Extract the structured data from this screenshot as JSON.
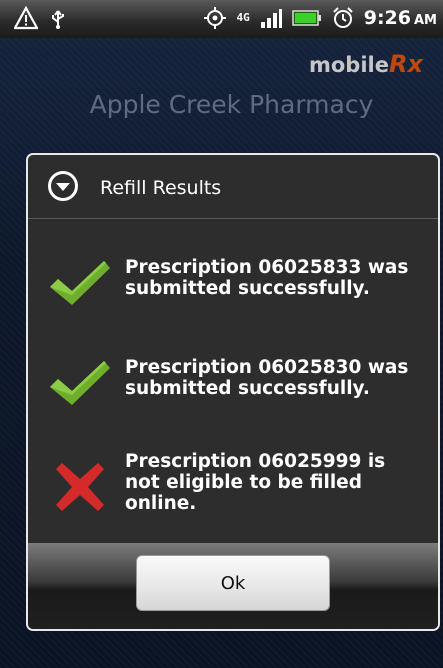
{
  "status_bar": {
    "time": "9:26",
    "ampm": "AM",
    "network_label": "4G",
    "icons": [
      "warning-icon",
      "usb-icon",
      "gps-icon",
      "data-4g-icon",
      "signal-icon",
      "battery-icon",
      "alarm-icon"
    ]
  },
  "app": {
    "brand_prefix": "mobile",
    "brand_rx": "Rx",
    "pharmacy_name": "Apple Creek Pharmacy"
  },
  "dialog": {
    "title": "Refill Results",
    "results": [
      {
        "icon": "check-icon",
        "text": "Prescription 06025833 was submitted successfully."
      },
      {
        "icon": "check-icon",
        "text": "Prescription 06025830 was submitted successfully."
      },
      {
        "icon": "error-x-icon",
        "text": "Prescription 06025999 is not eligible to be filled online."
      }
    ],
    "ok_label": "Ok"
  },
  "colors": {
    "success": "#6fae2c",
    "error": "#d42a2a",
    "dialog_bg": "#2d2d2d",
    "brand_rx": "#c0470e"
  }
}
